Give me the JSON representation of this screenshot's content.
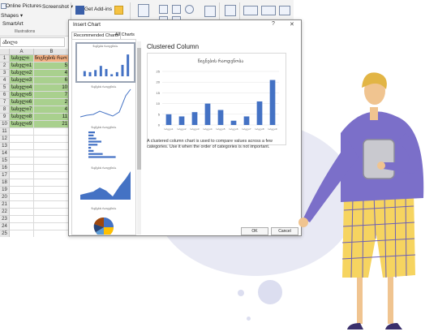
{
  "ribbon": {
    "online_pictures": "Online Pictures",
    "screenshot": "Screenshot",
    "shapes": "Shapes",
    "smartart": "SmartArt",
    "get_addins": "Get Add-ins",
    "illustrations": "Illustrations"
  },
  "namebox": "აზილი",
  "sheet": {
    "col_a": "A",
    "col_b": "B",
    "header_row": [
      "სახელი",
      "წიგნების რაო"
    ],
    "rows": [
      {
        "name": "სახელი1",
        "value": "5"
      },
      {
        "name": "სახელი2",
        "value": "4"
      },
      {
        "name": "სახელი3",
        "value": "6"
      },
      {
        "name": "სახელი4",
        "value": "10"
      },
      {
        "name": "სახელი5",
        "value": "7"
      },
      {
        "name": "სახელი6",
        "value": "2"
      },
      {
        "name": "სახელი7",
        "value": "4"
      },
      {
        "name": "სახელი8",
        "value": "11"
      },
      {
        "name": "სახელი9",
        "value": "21"
      }
    ],
    "row_numbers": [
      "1",
      "2",
      "3",
      "4",
      "5",
      "6",
      "7",
      "8",
      "9",
      "10",
      "11",
      "12",
      "13",
      "14",
      "15",
      "16",
      "17",
      "18",
      "19",
      "20",
      "21",
      "22",
      "23",
      "24",
      "25"
    ]
  },
  "dialog": {
    "title": "Insert Chart",
    "help": "?",
    "close": "✕",
    "tabs": [
      "Recommended Charts",
      "All Charts"
    ],
    "thumb_title": "წიგნების რაოდენობა",
    "chart_heading": "Clustered Column",
    "description": "A clustered column chart is used to compare values across a few categories. Use it when the order of categories is not important.",
    "ok": "OK",
    "cancel": "Cancel"
  },
  "chart_data": {
    "type": "bar",
    "title": "წიგნების რაოდენობა",
    "categories": [
      "სახელი1",
      "სახელი2",
      "სახელი3",
      "სახელი4",
      "სახელი5",
      "სახელი6",
      "სახელი7",
      "სახელი8",
      "სახელი9"
    ],
    "values": [
      5,
      4,
      6,
      10,
      7,
      2,
      4,
      11,
      21
    ],
    "ylim": [
      0,
      25
    ],
    "yticks": [
      0,
      5,
      10,
      15,
      20,
      25
    ],
    "grid": true,
    "color": "#4472c4"
  },
  "colors": {
    "accent": "#4472c4",
    "selection_fill": "#f4b183",
    "cell_fill": "#a9d08e",
    "person_shirt": "#7b6fc9",
    "person_shorts": "#f6d460",
    "blob": "#e8e9f4"
  }
}
